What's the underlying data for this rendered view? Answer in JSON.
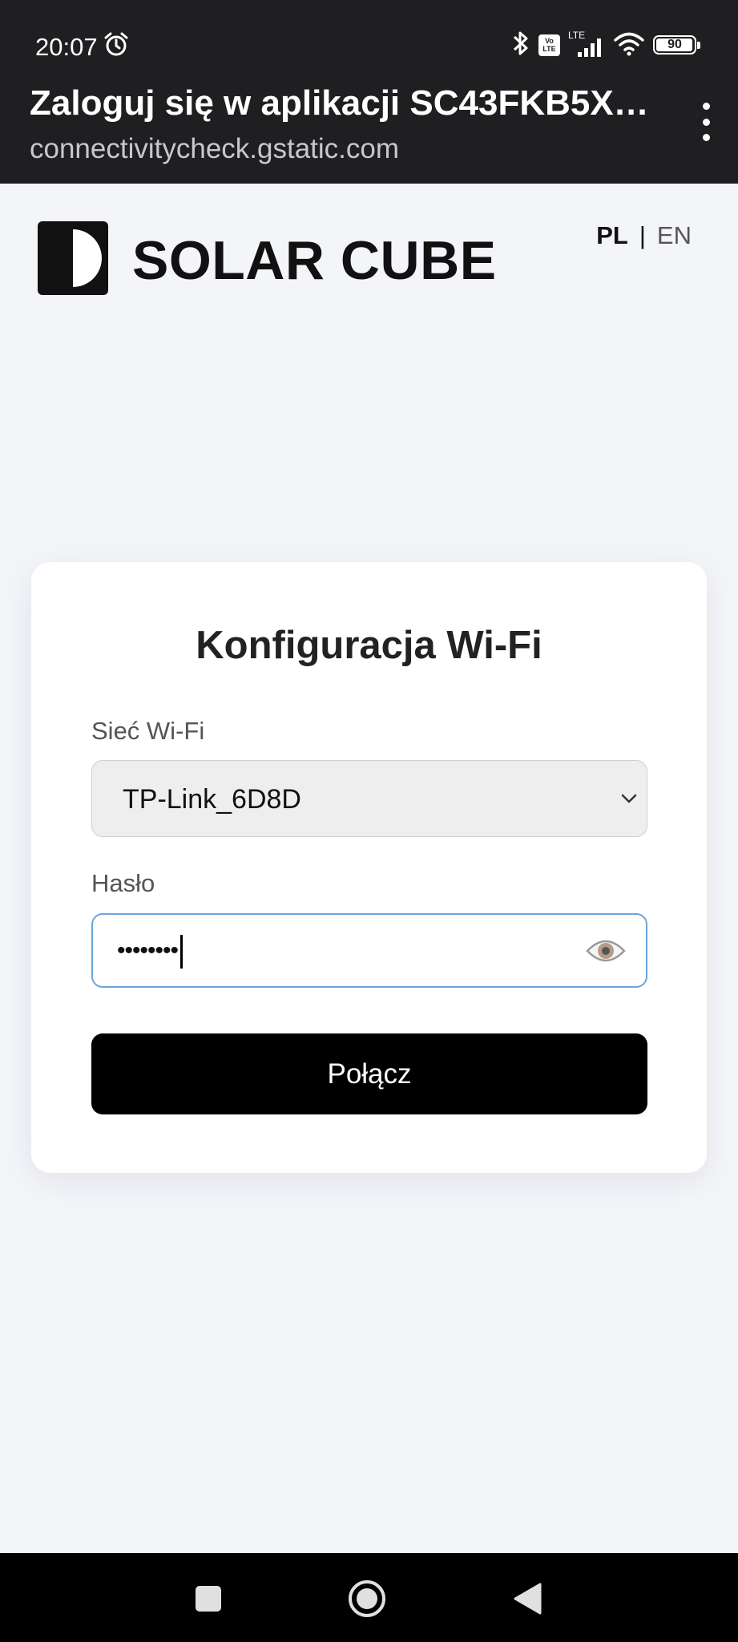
{
  "status_bar": {
    "time": "20:07",
    "volte_top": "Vo",
    "volte_bottom": "LTE",
    "network_label": "LTE",
    "battery_level": "90"
  },
  "browser": {
    "title": "Zaloguj się w aplikacji SC43FKB5X…",
    "url": "connectivitycheck.gstatic.com"
  },
  "header": {
    "brand": "SOLAR CUBE",
    "lang_active": "PL",
    "lang_separator": "|",
    "lang_other": "EN"
  },
  "form": {
    "title": "Konfiguracja Wi-Fi",
    "network_label": "Sieć Wi-Fi",
    "network_value": "TP-Link_6D8D",
    "password_label": "Hasło",
    "password_value": "••••••••",
    "connect_label": "Połącz"
  },
  "icons": {
    "clock": "alarm-icon",
    "bluetooth": "bluetooth-icon",
    "signal": "signal-icon",
    "wifi": "wifi-icon",
    "battery": "battery-icon",
    "menu": "more-vert-icon",
    "chevron": "chevron-down-icon",
    "eye": "eye-icon",
    "nav_recents": "square-icon",
    "nav_home": "home-circle-icon",
    "nav_back": "back-triangle-icon"
  },
  "colors": {
    "topbar": "#1f1f22",
    "page_bg": "#f4f5f9",
    "focus_border": "#6aa5db",
    "button": "#000000"
  }
}
